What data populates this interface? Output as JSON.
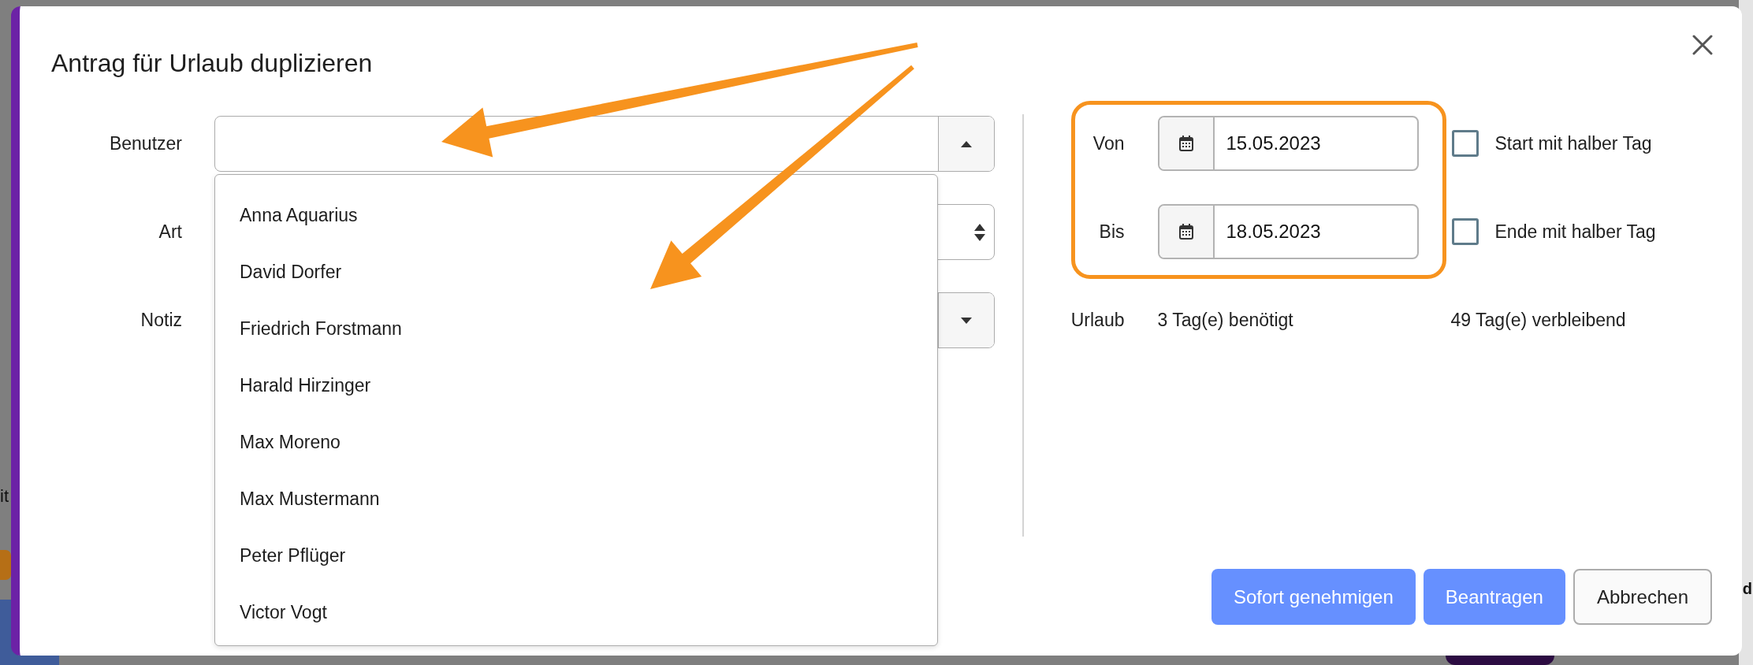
{
  "backdrop": {
    "left_text": "it",
    "right_text": "d"
  },
  "dialog": {
    "title": "Antrag für Urlaub duplizieren"
  },
  "form": {
    "fields": [
      {
        "kind": "combobox",
        "label": "Benutzer",
        "expanded": true,
        "options": [
          {
            "label": "Anna Aquarius",
            "selected": false
          },
          {
            "label": "David Dorfer",
            "selected": false
          },
          {
            "label": "Friedrich Forstmann",
            "selected": false
          },
          {
            "label": "Harald Hirzinger",
            "selected": false
          },
          {
            "label": "Max Moreno",
            "selected": false
          },
          {
            "label": "Max Mustermann",
            "selected": false
          },
          {
            "label": "Peter Pflüger",
            "selected": false
          },
          {
            "label": "Victor Vogt",
            "selected": false
          }
        ]
      },
      {
        "kind": "select",
        "label": "Art"
      },
      {
        "kind": "combobox",
        "label": "Notiz",
        "expanded": false
      }
    ]
  },
  "dates": [
    {
      "label": "Von",
      "value": "15.05.2023",
      "half_day_label": "Start mit halber Tag",
      "half_day_checked": false
    },
    {
      "label": "Bis",
      "value": "18.05.2023",
      "half_day_label": "Ende mit halber Tag",
      "half_day_checked": false
    }
  ],
  "summary": {
    "label": "Urlaub",
    "needed": "3 Tag(e) benötigt",
    "remaining": "49 Tag(e) verbleibend"
  },
  "buttons": [
    {
      "label": "Sofort genehmigen",
      "kind": "primary"
    },
    {
      "label": "Beantragen",
      "kind": "primary"
    },
    {
      "label": "Abbrechen",
      "kind": "secondary"
    }
  ]
}
